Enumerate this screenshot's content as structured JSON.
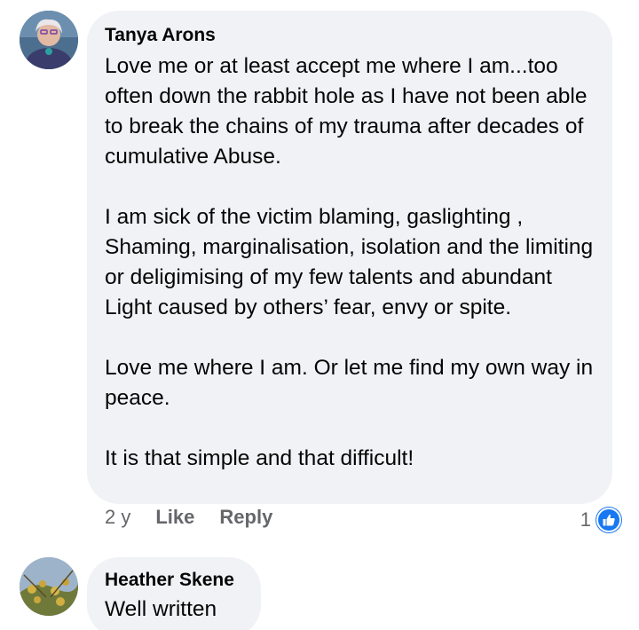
{
  "comments": [
    {
      "author": "Tanya Arons",
      "paragraphs": [
        "Love me or at least accept me where I am...too often down the rabbit hole as I have not been able to break the chains of my trauma after decades of cumulative Abuse.",
        "I am sick of the victim blaming, gaslighting , Shaming, marginalisation, isolation and the limiting or deligimising of my few talents and abundant Light caused by others’ fear, envy or spite.",
        "Love me where I am.  Or let me find my own way in peace.",
        "It is that simple and that difficult!"
      ],
      "time": "2 y",
      "like_label": "Like",
      "reply_label": "Reply",
      "reaction_count": "1",
      "reaction_icon": "thumbs-up-icon"
    },
    {
      "author": "Heather Skene",
      "paragraphs": [
        "Well written"
      ]
    }
  ],
  "colors": {
    "bubble": "#f0f2f5",
    "text": "#050505",
    "meta": "#65676b",
    "like_blue": "#1877f2"
  }
}
